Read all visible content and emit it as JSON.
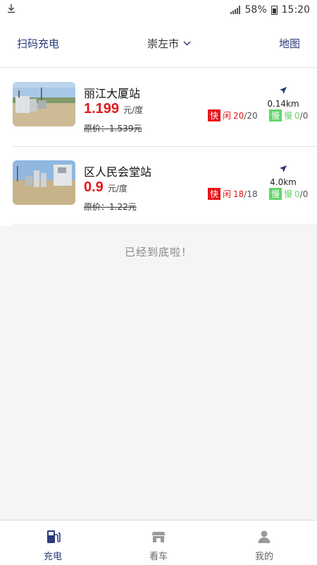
{
  "status_bar": {
    "battery": "58%",
    "time": "15:20"
  },
  "header": {
    "scan_label": "扫码充电",
    "city": "崇左市",
    "map_label": "地图"
  },
  "stations": [
    {
      "name": "丽江大厦站",
      "price": "1.199",
      "unit": "元/度",
      "original_label": "原价：",
      "original_price": "1.539元",
      "distance": "0.14km",
      "fast_tag": "快",
      "fast_label": "闲",
      "fast_available": "20",
      "fast_total": "/20",
      "slow_tag": "慢",
      "slow_label": "慢",
      "slow_available": "0",
      "slow_total": "/0"
    },
    {
      "name": "区人民会堂站",
      "price": "0.9",
      "unit": "元/度",
      "original_label": "原价：",
      "original_price": "1.22元",
      "distance": "4.0km",
      "fast_tag": "快",
      "fast_label": "闲",
      "fast_available": "18",
      "fast_total": "/18",
      "slow_tag": "慢",
      "slow_label": "慢",
      "slow_available": "0",
      "slow_total": "/0"
    }
  ],
  "end_text": "已经到底啦！",
  "tabs": [
    {
      "label": "充电",
      "icon": "charging-station-icon",
      "active": true
    },
    {
      "label": "看车",
      "icon": "store-icon",
      "active": false
    },
    {
      "label": "我的",
      "icon": "user-icon",
      "active": false
    }
  ],
  "colors": {
    "accent": "#2a3a7a",
    "price_red": "#e5161b",
    "slow_green": "#63d46a"
  }
}
